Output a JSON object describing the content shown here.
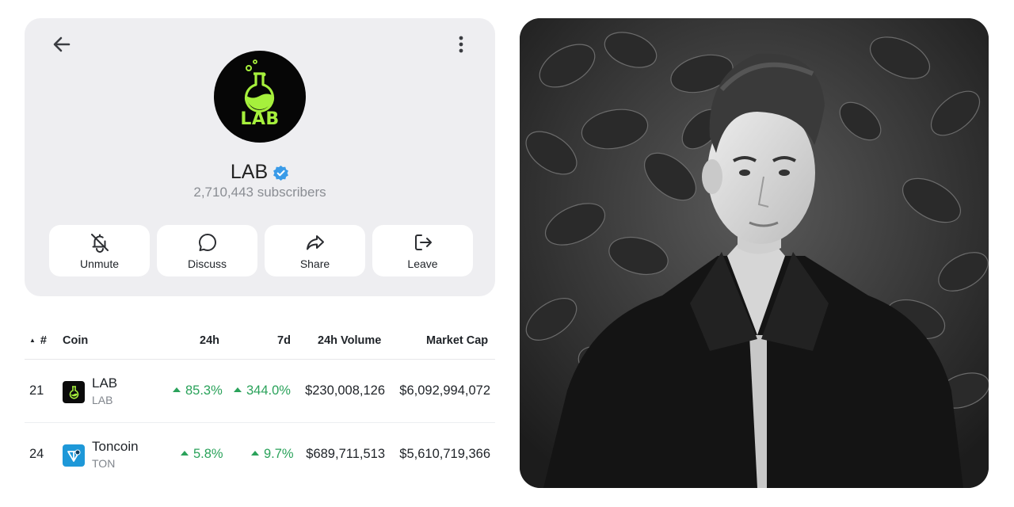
{
  "channel": {
    "name": "LAB",
    "subscribers": "2,710,443 subscribers",
    "avatar_text": "LAB",
    "verified": true,
    "accent_color": "#a6f03c",
    "actions": [
      {
        "label": "Unmute",
        "icon": "bell-off-icon"
      },
      {
        "label": "Discuss",
        "icon": "chat-bubble-icon"
      },
      {
        "label": "Share",
        "icon": "share-arrow-icon"
      },
      {
        "label": "Leave",
        "icon": "leave-door-icon"
      }
    ]
  },
  "table": {
    "headers": {
      "rank": "#",
      "coin": "Coin",
      "change_24h": "24h",
      "change_7d": "7d",
      "volume": "24h Volume",
      "market_cap": "Market Cap"
    },
    "rows": [
      {
        "rank": "21",
        "name": "LAB",
        "symbol": "LAB",
        "change_24h": "85.3%",
        "change_7d": "344.0%",
        "volume": "$230,008,126",
        "market_cap": "$6,092,994,072",
        "icon": "lab-flask-icon"
      },
      {
        "rank": "24",
        "name": "Toncoin",
        "symbol": "TON",
        "change_24h": "5.8%",
        "change_7d": "9.7%",
        "volume": "$689,711,513",
        "market_cap": "$5,610,719,366",
        "icon": "toncoin-icon"
      }
    ],
    "positive_color": "#2aa25a"
  },
  "photo": {
    "subject": "black-and-white portrait of a man in a dark blazer in front of leaves"
  }
}
